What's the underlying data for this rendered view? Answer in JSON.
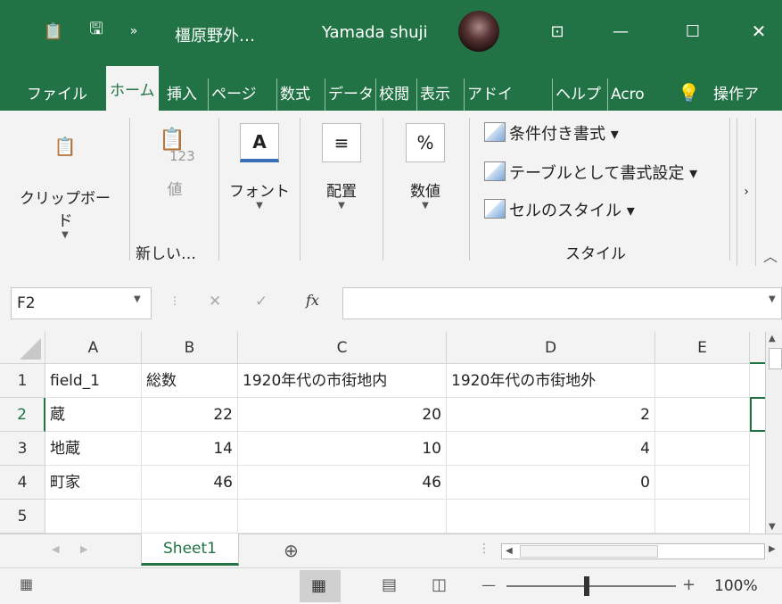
{
  "titlebar": {
    "filename": "橿原野外…",
    "user": "Yamada shuji",
    "more_glyph": "»",
    "save_glyph": "🖫",
    "ribbon_display_glyph": "⊡",
    "minimize_glyph": "—",
    "maximize_glyph": "☐",
    "close_glyph": "✕",
    "clipboard_glyph": "📋"
  },
  "tabs": [
    "ファイル",
    "ホーム",
    "挿入",
    "ページ",
    "数式",
    "データ",
    "校閲",
    "表示",
    "アドイ",
    "ヘルプ",
    "Acro",
    "操作ア"
  ],
  "tell_me_icon": "lightbulb-icon",
  "ribbon": {
    "clipboard": {
      "label": "クリップボード",
      "glyph": "📋"
    },
    "new_values": {
      "icon_sub": "123",
      "label": "値",
      "group_label": "新しい…"
    },
    "font": {
      "label": "フォント",
      "glyph": "A"
    },
    "alignment": {
      "label": "配置",
      "glyph": "≡"
    },
    "number": {
      "label": "数値",
      "glyph": "%"
    },
    "styles": {
      "conditional": "条件付き書式 ▾",
      "as_table": "テーブルとして書式設定 ▾",
      "cell_styles": "セルのスタイル ▾",
      "group_label": "スタイル"
    },
    "more_glyph": "›",
    "collapse_glyph": "︿"
  },
  "formula_bar": {
    "name_box": "F2",
    "cancel_glyph": "✕",
    "enter_glyph": "✓",
    "fx_glyph": "fx",
    "formula": ""
  },
  "columns": [
    "A",
    "B",
    "C",
    "D",
    "E"
  ],
  "rows": [
    {
      "num": "1",
      "cells": [
        "field_1",
        "総数",
        "1920年代の市街地内",
        "1920年代の市街地外",
        ""
      ]
    },
    {
      "num": "2",
      "cells": [
        "蔵",
        "22",
        "20",
        "2",
        ""
      ]
    },
    {
      "num": "3",
      "cells": [
        "地蔵",
        "14",
        "10",
        "4",
        ""
      ]
    },
    {
      "num": "4",
      "cells": [
        "町家",
        "46",
        "46",
        "0",
        ""
      ]
    },
    {
      "num": "5",
      "cells": [
        "",
        "",
        "",
        "",
        ""
      ]
    }
  ],
  "sheet_tabs": [
    "Sheet1"
  ],
  "add_sheet_glyph": "⊕",
  "status": {
    "zoom": "100%",
    "minus": "—",
    "plus": "+"
  },
  "colors": {
    "accent": "#217346",
    "ribbon_bg": "#f3f3f3"
  }
}
